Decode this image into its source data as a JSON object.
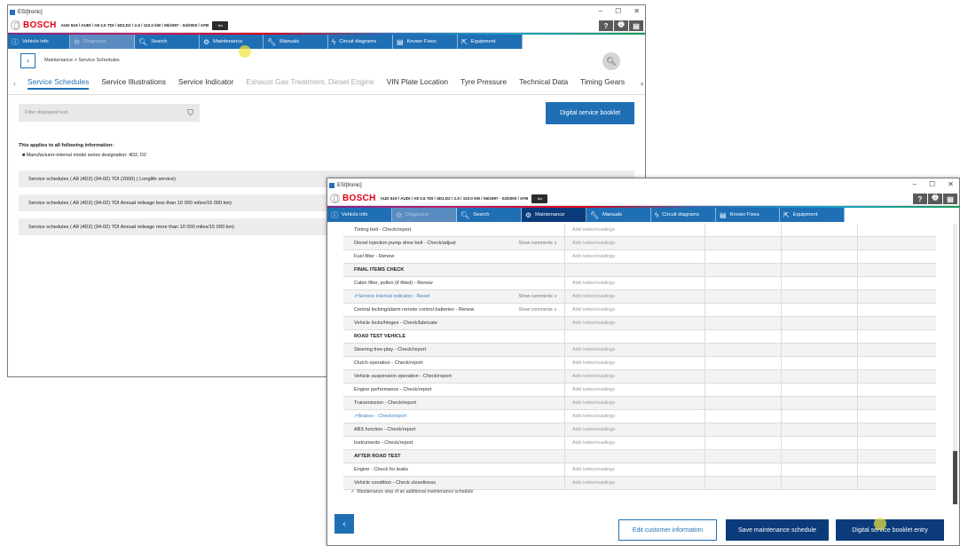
{
  "window_title": "ESI[tronic]",
  "title_controls": [
    "–",
    "☐",
    "✕"
  ],
  "brand": "BOSCH",
  "vehicle": "AUD 619 / AUDI / A8 2.5 TDI / 4D2,D2 / 2.5 / 110.0 kW / 06/1997 - 04/2000 / AFB",
  "top_right_buttons": [
    "?",
    "🖶",
    "▤"
  ],
  "nav": {
    "vehicle_info": "Vehicle info",
    "diagnosis": "Diagnosis",
    "search": "Search",
    "maintenance": "Maintenance",
    "manuals": "Manuals",
    "circuit_diagrams": "Circuit diagrams",
    "known_fixes": "Known Fixes",
    "equipment": "Equipment"
  },
  "w1": {
    "breadcrumb": "Maintenance > Service Schedules",
    "tabs": [
      "Service Schedules",
      "Service Illustrations",
      "Service Indicator",
      "Exhaust Gas Treatment, Diesel Engine",
      "VIN Plate Location",
      "Tyre Pressure",
      "Technical Data",
      "Timing Gears"
    ],
    "filter_placeholder": "Filter displayed text",
    "digital_booklet": "Digital service booklet",
    "info_heading": "This applies to all following information:",
    "info_bullet": "Manufacturer-internal model series designation: 4D2, D2",
    "schedules": [
      "Service schedules ( A8 (4D2) (94-02) TDI (2000) ( Longlife service)",
      "Service schedules ( A8 (4D2) (94-02) TDI Annual mileage less than 10 000 miles/15 000 km)",
      "Service schedules ( A8 (4D2) (94-02) TDI Annual mileage more than 10 000 miles/15 000 km)"
    ]
  },
  "w2": {
    "notes_placeholder": "Add notes/readings",
    "show_comments": "Show comments",
    "rows": [
      {
        "type": "item",
        "text": "Timing belt - Check/report"
      },
      {
        "type": "item",
        "text": "Diesel injection pump drive belt - Check/adjust",
        "comments": true
      },
      {
        "type": "item",
        "text": "Fuel filter - Renew"
      },
      {
        "type": "section",
        "text": "FINAL ITEMS CHECK"
      },
      {
        "type": "item",
        "text": "Cabin filter, pollen (if fitted) - Renew"
      },
      {
        "type": "link",
        "text": "Service interval indicator - Reset",
        "comments": true
      },
      {
        "type": "item",
        "text": "Central locking/alarm remote control batteries - Renew",
        "comments": true
      },
      {
        "type": "item",
        "text": "Vehicle locks/hinges - Check/lubricate"
      },
      {
        "type": "section",
        "text": "ROAD TEST VEHICLE"
      },
      {
        "type": "item",
        "text": "Steering free-play - Check/report"
      },
      {
        "type": "item",
        "text": "Clutch operation - Check/report"
      },
      {
        "type": "item",
        "text": "Vehicle suspension operation - Check/report"
      },
      {
        "type": "item",
        "text": "Engine performance - Check/report"
      },
      {
        "type": "item",
        "text": "Transmission - Check/report"
      },
      {
        "type": "link",
        "text": "Brakes - Check/report"
      },
      {
        "type": "item",
        "text": "ABS function - Check/report"
      },
      {
        "type": "item",
        "text": "Instruments - Check/report"
      },
      {
        "type": "section",
        "text": "AFTER ROAD TEST"
      },
      {
        "type": "item",
        "text": "Engine - Check for leaks"
      },
      {
        "type": "item",
        "text": "Vehicle condition - Check cleanliness"
      }
    ],
    "legend": "Maintenance step of an additional maintenance schedule",
    "edit_customer": "Edit customer information",
    "save_schedule": "Save maintenance schedule",
    "booklet_entry": "Digital service booklet entry"
  },
  "colors": {
    "nav_blue": "#1f6fb5",
    "nav_active": "#0b3b7a",
    "bosch_red": "#e20015"
  },
  "icons": {
    "vehicle_info": "info-icon",
    "search": "search-icon",
    "maintenance": "gears-icon",
    "manuals": "wrench-icon",
    "circuit": "lightning-icon",
    "known_fixes": "book-icon",
    "equipment": "external-link-icon",
    "filter": "funnel-icon"
  }
}
